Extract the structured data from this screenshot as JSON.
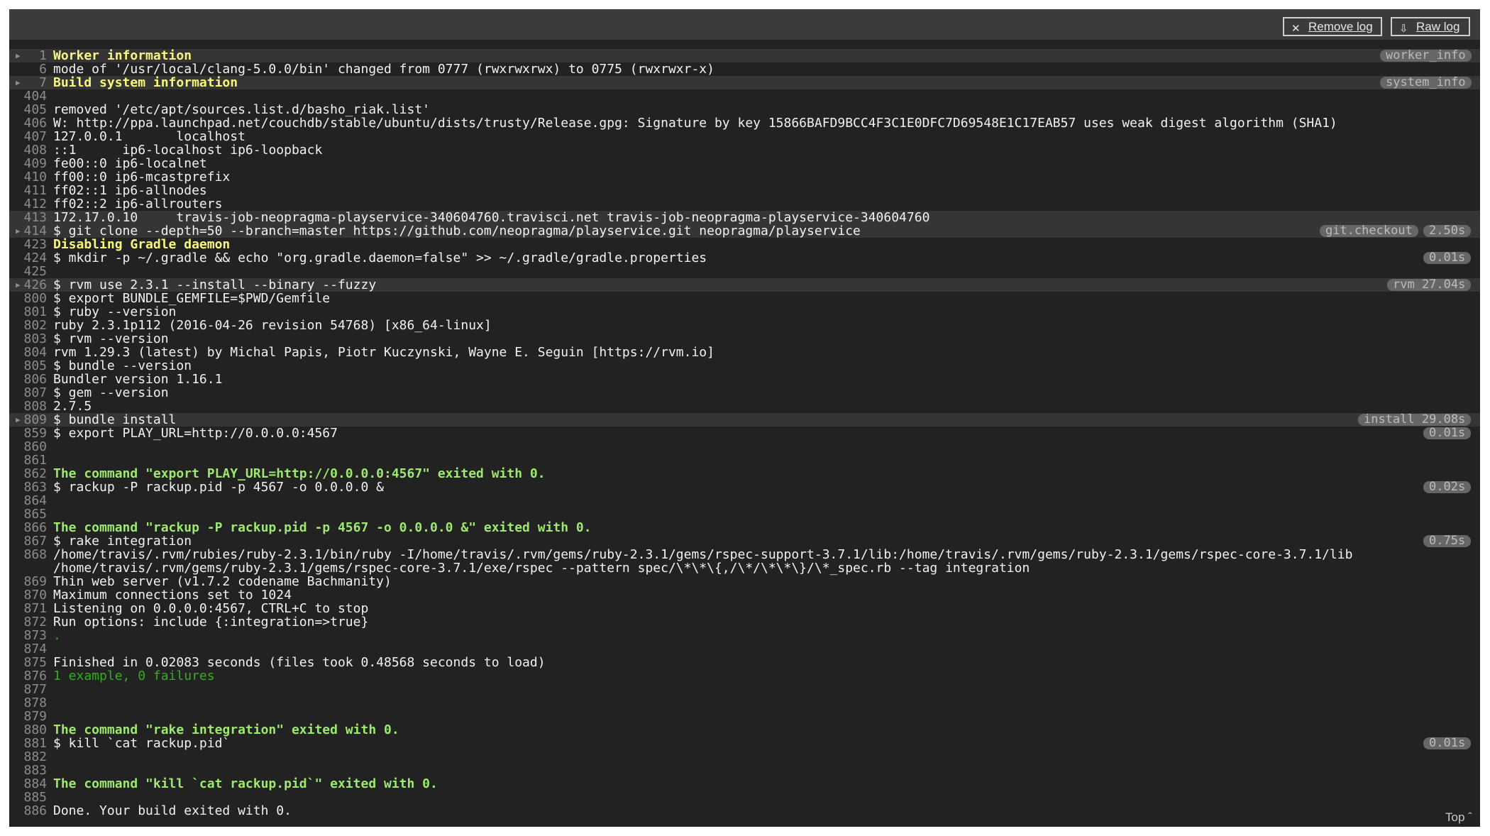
{
  "toolbar": {
    "remove_log": "Remove log",
    "raw_log": "Raw log",
    "top_link": "Top ˆ"
  },
  "lines": [
    {
      "num": "1",
      "text": "Worker information",
      "style": "yellow",
      "fold": true,
      "hl": true,
      "badges": [
        "worker_info"
      ]
    },
    {
      "num": "6",
      "text": "mode of '/usr/local/clang-5.0.0/bin' changed from 0777 (rwxrwxrwx) to 0775 (rwxrwxr-x)"
    },
    {
      "num": "7",
      "text": "Build system information",
      "style": "yellow",
      "fold": true,
      "hl": true,
      "badges": [
        "system_info"
      ]
    },
    {
      "num": "404",
      "text": ""
    },
    {
      "num": "405",
      "text": "removed '/etc/apt/sources.list.d/basho_riak.list'"
    },
    {
      "num": "406",
      "text": "W: http://ppa.launchpad.net/couchdb/stable/ubuntu/dists/trusty/Release.gpg: Signature by key 15866BAFD9BCC4F3C1E0DFC7D69548E1C17EAB57 uses weak digest algorithm (SHA1)"
    },
    {
      "num": "407",
      "text": "127.0.0.1\tlocalhost"
    },
    {
      "num": "408",
      "text": "::1\t ip6-localhost ip6-loopback"
    },
    {
      "num": "409",
      "text": "fe00::0 ip6-localnet"
    },
    {
      "num": "410",
      "text": "ff00::0 ip6-mcastprefix"
    },
    {
      "num": "411",
      "text": "ff02::1 ip6-allnodes"
    },
    {
      "num": "412",
      "text": "ff02::2 ip6-allrouters"
    },
    {
      "num": "413",
      "text": "172.17.0.10\ttravis-job-neopragma-playservice-340604760.travisci.net travis-job-neopragma-playservice-340604760",
      "hl": true
    },
    {
      "num": "414",
      "text": "$ git clone --depth=50 --branch=master https://github.com/neopragma/playservice.git neopragma/playservice",
      "fold": true,
      "hl": true,
      "badges": [
        "git.checkout",
        "2.50s"
      ]
    },
    {
      "num": "423",
      "text": "Disabling Gradle daemon",
      "style": "yellow"
    },
    {
      "num": "424",
      "text": "$ mkdir -p ~/.gradle && echo \"org.gradle.daemon=false\" >> ~/.gradle/gradle.properties",
      "badges": [
        "0.01s"
      ]
    },
    {
      "num": "425",
      "text": ""
    },
    {
      "num": "426",
      "text": "$ rvm use 2.3.1 --install --binary --fuzzy",
      "fold": true,
      "hl": true,
      "badges": [
        "rvm 27.04s"
      ]
    },
    {
      "num": "800",
      "text": "$ export BUNDLE_GEMFILE=$PWD/Gemfile"
    },
    {
      "num": "801",
      "text": "$ ruby --version"
    },
    {
      "num": "802",
      "text": "ruby 2.3.1p112 (2016-04-26 revision 54768) [x86_64-linux]"
    },
    {
      "num": "803",
      "text": "$ rvm --version"
    },
    {
      "num": "804",
      "text": "rvm 1.29.3 (latest) by Michal Papis, Piotr Kuczynski, Wayne E. Seguin [https://rvm.io]"
    },
    {
      "num": "805",
      "text": "$ bundle --version"
    },
    {
      "num": "806",
      "text": "Bundler version 1.16.1"
    },
    {
      "num": "807",
      "text": "$ gem --version"
    },
    {
      "num": "808",
      "text": "2.7.5"
    },
    {
      "num": "809",
      "text": "$ bundle install",
      "fold": true,
      "hl": true,
      "badges": [
        "install 29.08s"
      ]
    },
    {
      "num": "859",
      "text": "$ export PLAY_URL=http://0.0.0.0:4567",
      "badges": [
        "0.01s"
      ]
    },
    {
      "num": "860",
      "text": ""
    },
    {
      "num": "861",
      "text": ""
    },
    {
      "num": "862",
      "text": "The command \"export PLAY_URL=http://0.0.0.0:4567\" exited with 0.",
      "style": "green"
    },
    {
      "num": "863",
      "text": "$ rackup -P rackup.pid -p 4567 -o 0.0.0.0 &",
      "badges": [
        "0.02s"
      ]
    },
    {
      "num": "864",
      "text": ""
    },
    {
      "num": "865",
      "text": ""
    },
    {
      "num": "866",
      "text": "The command \"rackup -P rackup.pid -p 4567 -o 0.0.0.0 &\" exited with 0.",
      "style": "green"
    },
    {
      "num": "867",
      "text": "$ rake integration",
      "badges": [
        "0.75s"
      ]
    },
    {
      "num": "868",
      "text": "/home/travis/.rvm/rubies/ruby-2.3.1/bin/ruby -I/home/travis/.rvm/gems/ruby-2.3.1/gems/rspec-support-3.7.1/lib:/home/travis/.rvm/gems/ruby-2.3.1/gems/rspec-core-3.7.1/lib\n/home/travis/.rvm/gems/ruby-2.3.1/gems/rspec-core-3.7.1/exe/rspec --pattern spec/\\*\\*\\{,/\\*/\\*\\*\\}/\\*_spec.rb --tag integration",
      "wrap": true
    },
    {
      "num": "869",
      "text": "Thin web server (v1.7.2 codename Bachmanity)"
    },
    {
      "num": "870",
      "text": "Maximum connections set to 1024"
    },
    {
      "num": "871",
      "text": "Listening on 0.0.0.0:4567, CTRL+C to stop"
    },
    {
      "num": "872",
      "text": "Run options: include {:integration=>true}"
    },
    {
      "num": "873",
      "text": ".",
      "style": "green2"
    },
    {
      "num": "874",
      "text": ""
    },
    {
      "num": "875",
      "text": "Finished in 0.02083 seconds (files took 0.48568 seconds to load)"
    },
    {
      "num": "876",
      "text": "1 example, 0 failures",
      "style": "green2"
    },
    {
      "num": "877",
      "text": ""
    },
    {
      "num": "878",
      "text": ""
    },
    {
      "num": "879",
      "text": ""
    },
    {
      "num": "880",
      "text": "The command \"rake integration\" exited with 0.",
      "style": "green"
    },
    {
      "num": "881",
      "text": "$ kill `cat rackup.pid`",
      "badges": [
        "0.01s"
      ]
    },
    {
      "num": "882",
      "text": ""
    },
    {
      "num": "883",
      "text": ""
    },
    {
      "num": "884",
      "text": "The command \"kill `cat rackup.pid`\" exited with 0.",
      "style": "green"
    },
    {
      "num": "885",
      "text": ""
    },
    {
      "num": "886",
      "text": "Done. Your build exited with 0."
    }
  ]
}
